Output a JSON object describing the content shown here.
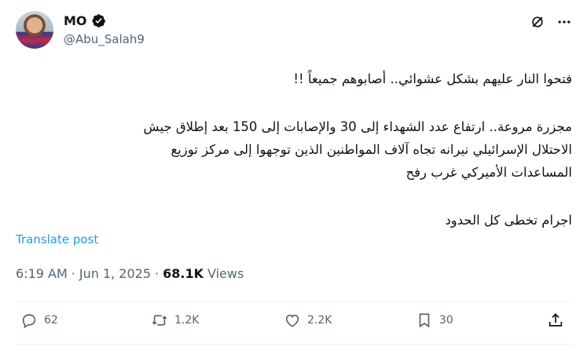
{
  "author": {
    "name": "MO",
    "handle": "@Abu_Salah9",
    "verified": true
  },
  "post": {
    "paragraph1": "فتحوا النار عليهم بشكل عشوائي.. أصابوهم جميعاً !!",
    "paragraph2": "مجزرة مروعة.. ارتفاع عدد الشهداء إلى 30 والإصابات إلى 150 بعد إطلاق جيش\nالاحتلال الإسرائيلي نيرانه تجاه آلاف المواطنين الذين توجهوا إلى مركز توزيع\nالمساعدات الأميركي غرب رفح",
    "paragraph3": "اجرام تخطى كل الحدود"
  },
  "translate_label": "Translate post",
  "meta": {
    "time": "6:19 AM",
    "sep1": "·",
    "date": "Jun 1, 2025",
    "sep2": "·",
    "views_count": "68.1K",
    "views_label": "Views"
  },
  "actions": {
    "replies": "62",
    "reposts": "1.2K",
    "likes": "2.2K",
    "bookmarks": "30"
  },
  "icons": [
    "verified-icon",
    "grok-icon",
    "more-icon",
    "reply-icon",
    "repost-icon",
    "like-icon",
    "bookmark-icon",
    "share-icon"
  ],
  "colors": {
    "accent": "#1d9bf0",
    "secondary_text": "#536471",
    "text": "#0f1419"
  }
}
